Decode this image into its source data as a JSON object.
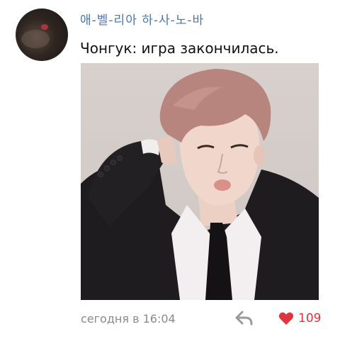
{
  "post": {
    "author_name": "애-벨-리아 하-사-노-바",
    "message": "Чонгук: игра закончилась.",
    "timestamp": "сегодня в 16:04",
    "likes": "109"
  },
  "icons": {
    "reply": "reply-arrow-icon",
    "like": "heart-icon"
  },
  "colors": {
    "author": "#4a77b3",
    "like": "#e0343e",
    "meta": "#8a8a8a"
  }
}
